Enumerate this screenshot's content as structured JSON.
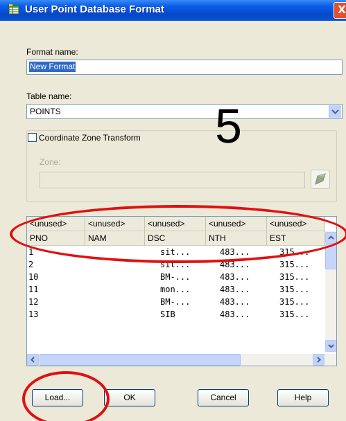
{
  "window": {
    "title": "User Point Database Format",
    "close_glyph": "X"
  },
  "format_name": {
    "label": "Format name:",
    "value": "New Format"
  },
  "table_name": {
    "label": "Table name:",
    "value": "POINTS"
  },
  "annotation": {
    "number": "5"
  },
  "coordinate_zone": {
    "checkbox_label": "Coordinate Zone Transform",
    "checked": false,
    "zone_label": "Zone:",
    "zone_value": ""
  },
  "grid": {
    "top_headers": [
      "<unused>",
      "<unused>",
      "<unused>",
      "<unused>",
      "<unused>"
    ],
    "columns": [
      "PNO",
      "NAM",
      "DSC",
      "NTH",
      "EST"
    ],
    "rows": [
      [
        "1",
        "",
        "sit...",
        "483...",
        "315..."
      ],
      [
        "2",
        "",
        "sit...",
        "483...",
        "315..."
      ],
      [
        "10",
        "",
        "BM-...",
        "483...",
        "315..."
      ],
      [
        "11",
        "",
        "mon...",
        "483...",
        "315..."
      ],
      [
        "12",
        "",
        "BM-...",
        "483...",
        "315..."
      ],
      [
        "13",
        "",
        "SIB",
        "483...",
        "315..."
      ]
    ]
  },
  "buttons": {
    "load": "Load...",
    "ok": "OK",
    "cancel": "Cancel",
    "help": "Help"
  },
  "colors": {
    "titlebar": "#0a5ce8",
    "selection": "#316ac5",
    "annotation_red": "#e01010",
    "dialog_bg": "#ece9d8"
  },
  "icons": {
    "title": "database-icon",
    "pick": "pick-point-icon"
  }
}
